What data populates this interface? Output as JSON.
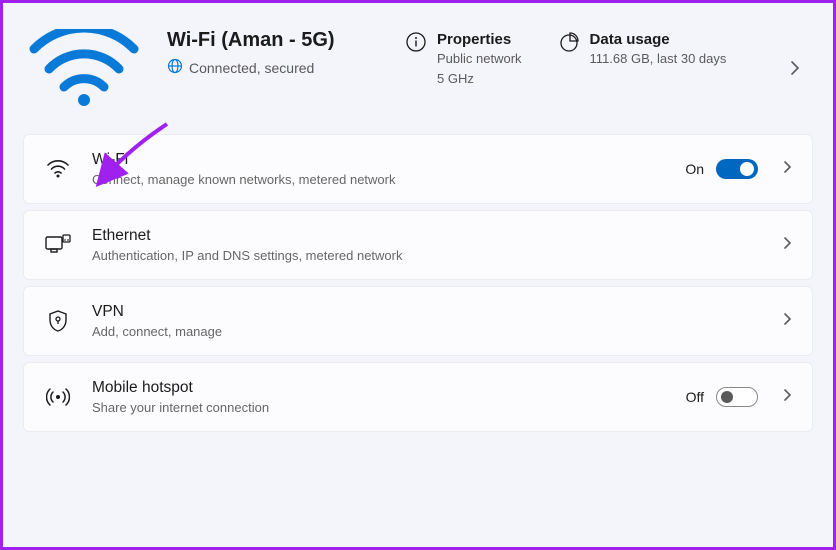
{
  "header": {
    "network_name": "Wi-Fi (Aman - 5G)",
    "status": "Connected, secured",
    "properties": {
      "title": "Properties",
      "line1": "Public network",
      "line2": "5 GHz"
    },
    "data_usage": {
      "title": "Data usage",
      "summary": "111.68 GB, last 30 days"
    }
  },
  "rows": {
    "wifi": {
      "title": "Wi-Fi",
      "sub": "Connect, manage known networks, metered network",
      "state_label": "On",
      "on": true
    },
    "ethernet": {
      "title": "Ethernet",
      "sub": "Authentication, IP and DNS settings, metered network"
    },
    "vpn": {
      "title": "VPN",
      "sub": "Add, connect, manage"
    },
    "hotspot": {
      "title": "Mobile hotspot",
      "sub": "Share your internet connection",
      "state_label": "Off",
      "on": false
    }
  }
}
